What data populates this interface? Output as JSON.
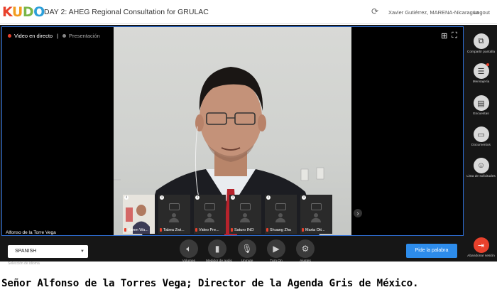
{
  "app": {
    "logo_letters": [
      "K",
      "U",
      "D",
      "O"
    ],
    "event_title": "DAY 2: AHEG Regional Consultation for GRULAC",
    "user": "Xavier Gutiérrez, MARENA-Nicaragua",
    "logout_label": "Logout"
  },
  "video": {
    "tabs": [
      {
        "label": "Video en directo",
        "active": true
      },
      {
        "label": "Presentación",
        "active": false
      }
    ],
    "speaker_label": "Alfonso de la Torre Vega",
    "thumbnails": [
      {
        "name": "Karen Wa..."
      },
      {
        "name": "Tabea Zwi..."
      },
      {
        "name": "Video Pre..."
      },
      {
        "name": "Saturo INO"
      },
      {
        "name": "Shuang Zhu"
      },
      {
        "name": "Marta Ott..."
      }
    ]
  },
  "sidebar": [
    {
      "label": "Compartir pantalla",
      "icon": "share-screen-icon"
    },
    {
      "label": "Mensajería",
      "icon": "chat-icon",
      "badge": true
    },
    {
      "label": "Encuestas",
      "icon": "poll-icon"
    },
    {
      "label": "Documentos",
      "icon": "document-icon"
    },
    {
      "label": "Lista de solicitudes",
      "icon": "request-list-icon"
    },
    {
      "label": "Abandonar sesión",
      "icon": "leave-icon"
    }
  ],
  "controls": {
    "language_value": "SPANISH",
    "language_hint": "Selección de idioma",
    "buttons": [
      {
        "label": "Volumen",
        "icon": "volume-icon"
      },
      {
        "label": "Medidor de audio",
        "icon": "audio-meter-icon"
      },
      {
        "label": "Unmute",
        "icon": "microphone-icon"
      },
      {
        "label": "Turn On",
        "icon": "camera-icon"
      },
      {
        "label": "Ajustes",
        "icon": "gear-icon"
      }
    ],
    "request_floor_label": "Pide la palabra"
  },
  "caption": "Señor Alfonso de la Torres Vega; Director de la Agenda Gris de México.",
  "colors": {
    "accent": "#2d8ceb",
    "frame": "#2f6fd6",
    "leave": "#e8412c"
  }
}
